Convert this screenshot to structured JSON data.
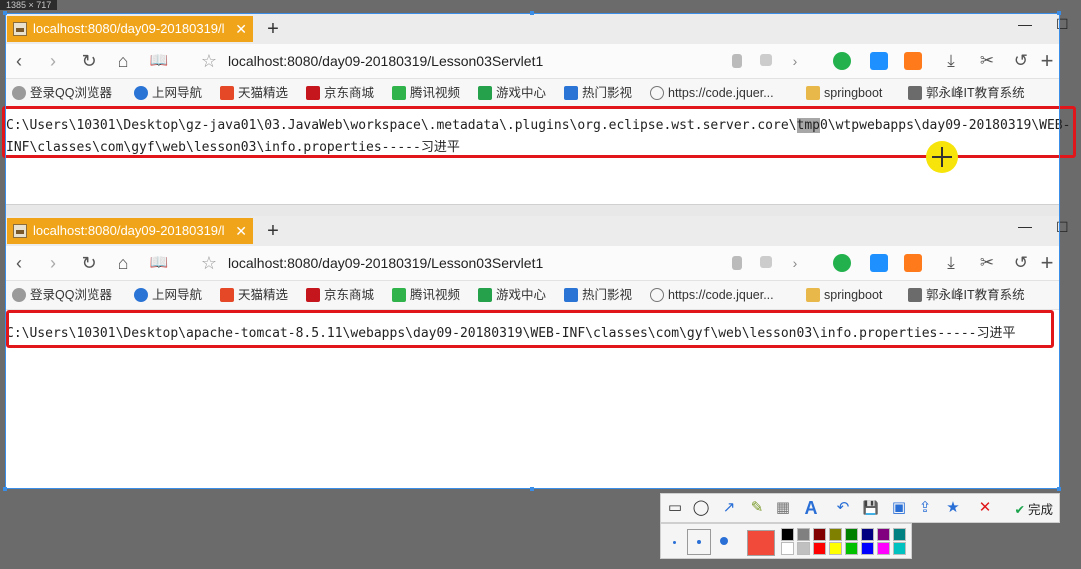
{
  "size_label": "1385 × 717",
  "win_controls": {
    "minimize": "—",
    "maximize": "☐"
  },
  "tab": {
    "title": "localhost:8080/day09-20180319/l",
    "close": "✕",
    "new_tab": "+"
  },
  "nav": {
    "back": "‹",
    "forward": "›",
    "refresh": "↻",
    "home": "⌂",
    "reader": "📖",
    "star": "☆",
    "url": "localhost:8080/day09-20180319/Lesson03Servlet1",
    "more": "+"
  },
  "bookmarks": [
    {
      "label": "登录QQ浏览器",
      "icon": "qq-user-icon",
      "color": "#9a9a9a"
    },
    {
      "label": "上网导航",
      "icon": "ie-e-icon",
      "color": "#2a74d5"
    },
    {
      "label": "天猫精选",
      "icon": "tmall-icon",
      "color": "#e44826"
    },
    {
      "label": "京东商城",
      "icon": "jd-icon",
      "color": "#c4161c"
    },
    {
      "label": "腾讯视频",
      "icon": "play-icon",
      "color": "#2fb34a"
    },
    {
      "label": "游戏中心",
      "icon": "gamepad-icon",
      "color": "#24a14a"
    },
    {
      "label": "热门影视",
      "icon": "movie-icon",
      "color": "#2a74d5"
    },
    {
      "label": "https://code.jquer...",
      "icon": "globe-icon",
      "color": "#777777"
    },
    {
      "label": "springboot",
      "icon": "folder-icon",
      "color": "#e8b84a"
    },
    {
      "label": "郭永峰IT教育系统",
      "icon": "image-icon",
      "color": "#6b6b6b"
    }
  ],
  "page1": {
    "line1_a": "C:\\Users\\10301\\Desktop\\gz-java01\\03.JavaWeb\\workspace\\.metadata\\.plugins\\org.eclipse.wst.server.core\\",
    "line1_hl": "tmp",
    "line1_b": "0\\wtpwebapps\\day09-20180319\\WEB-",
    "line2": "INF\\classes\\com\\gyf\\web\\lesson03\\info.properties-----习进平"
  },
  "page2": {
    "line1": "C:\\Users\\10301\\Desktop\\apache-tomcat-8.5.11\\webapps\\day09-20180319\\WEB-INF\\classes\\com\\gyf\\web\\lesson03\\info.properties-----习进平"
  },
  "annot": {
    "rect": "▭",
    "ellipse": "◯",
    "arrow": "↗",
    "pen": "✎",
    "mosaic": "▦",
    "text": "A",
    "undo": "↶",
    "save": "💾",
    "copy": "▣",
    "share": "⇪",
    "pin": "★",
    "cancel": "✕",
    "done_check": "✔",
    "done_label": "完成",
    "selected_color": "#f24a3a",
    "palette_top": [
      "#000000",
      "#808080",
      "#800000",
      "#808000",
      "#008000",
      "#000080",
      "#800080",
      "#008080"
    ],
    "palette_bottom": [
      "#ffffff",
      "#c0c0c0",
      "#ff0000",
      "#ffff00",
      "#00c000",
      "#0000ff",
      "#ff00ff",
      "#00c0c0"
    ]
  }
}
